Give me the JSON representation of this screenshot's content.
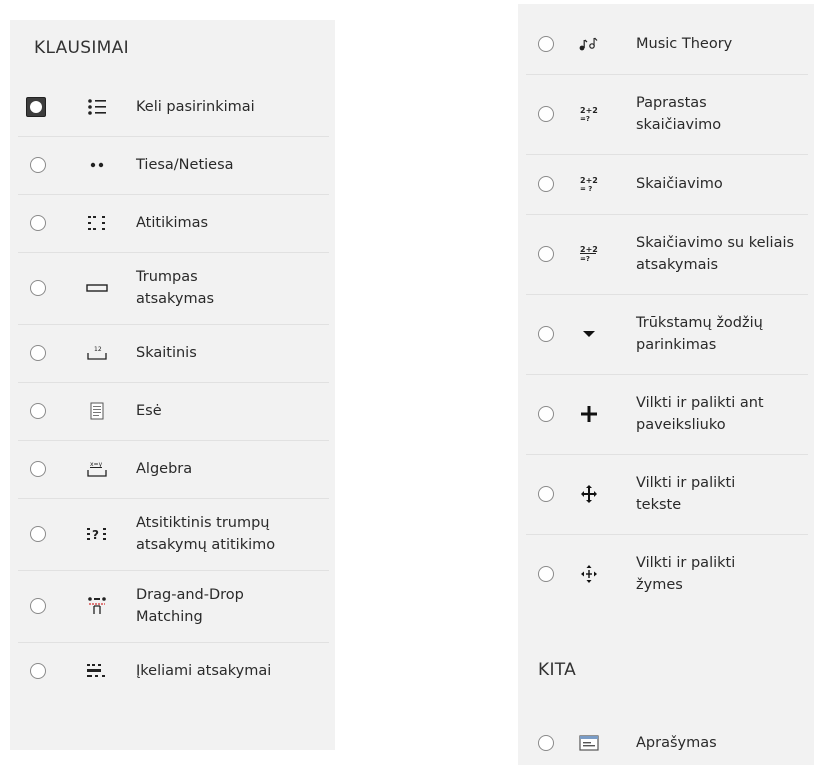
{
  "left": {
    "heading": "KLAUSIMAI",
    "items": [
      {
        "label": "Keli pasirinkimai",
        "icon": "multiple-choice-icon"
      },
      {
        "label": "Tiesa/Netiesa",
        "icon": "true-false-icon"
      },
      {
        "label": "Atitikimas",
        "icon": "matching-icon"
      },
      {
        "label": "Trumpas atsakymas",
        "icon": "short-answer-icon"
      },
      {
        "label": "Skaitinis",
        "icon": "numerical-icon"
      },
      {
        "label": "Esė",
        "icon": "essay-icon"
      },
      {
        "label": "Algebra",
        "icon": "algebra-icon"
      },
      {
        "label": "Atsitiktinis trumpų atsakymų atitikimo",
        "icon": "random-short-answer-matching-icon"
      },
      {
        "label": "Drag-and-Drop Matching",
        "icon": "drag-drop-matching-icon"
      },
      {
        "label": "Įkeliami atsakymai",
        "icon": "upload-answers-icon"
      }
    ]
  },
  "right": {
    "items": [
      {
        "label": "Music Theory",
        "icon": "music-notes-icon"
      },
      {
        "label": "Paprastas skaičiavimo",
        "icon": "calculated-simple-icon"
      },
      {
        "label": "Skaičiavimo",
        "icon": "calculated-icon"
      },
      {
        "label": "Skaičiavimo su keliais atsakymais",
        "icon": "calculated-multichoice-icon"
      },
      {
        "label": "Trūkstamų žodžių parinkimas",
        "icon": "caret-down-icon"
      },
      {
        "label": "Vilkti ir palikti ant paveiksliuko",
        "icon": "plus-cross-icon"
      },
      {
        "label": "Vilkti ir palikti tekste",
        "icon": "move-arrows-icon"
      },
      {
        "label": "Vilkti ir palikti žymes",
        "icon": "move-markers-icon"
      }
    ],
    "other_heading": "KITA",
    "other_items": [
      {
        "label": "Aprašymas",
        "icon": "description-icon"
      }
    ]
  }
}
